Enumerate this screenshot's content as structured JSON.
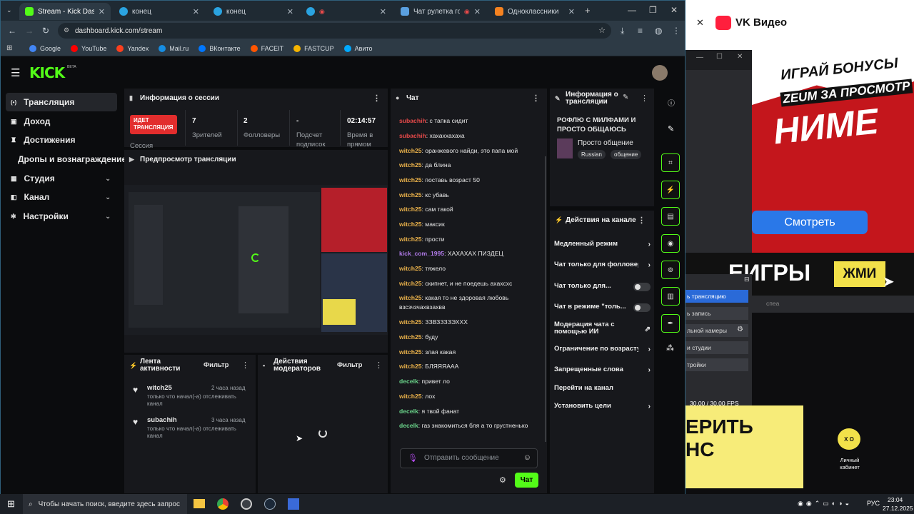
{
  "browser": {
    "tabs": [
      {
        "title": "Stream - Kick Dashboard",
        "color": "#53fc18"
      },
      {
        "title": "конец",
        "color": "#2aa3e0"
      },
      {
        "title": "конец",
        "color": "#2aa3e0"
      },
      {
        "title": "",
        "color": "#2aa3e0"
      },
      {
        "title": "Чат рулетка голос",
        "color": "#5aa0e0"
      },
      {
        "title": "Одноклассники",
        "color": "#f58220"
      }
    ],
    "url": "dashboard.kick.com/stream",
    "bookmarks": [
      "Google",
      "YouTube",
      "Yandex",
      "Mail.ru",
      "ВКонтакте",
      "FACEIT",
      "FASTCUP",
      "Авито"
    ]
  },
  "kick": {
    "logo": "KICK",
    "logo_badge": "BETA",
    "sidebar": [
      {
        "label": "Трансляция",
        "icon": "broadcast-icon"
      },
      {
        "label": "Доход",
        "icon": "wallet-icon"
      },
      {
        "label": "Достижения",
        "icon": "trophy-icon"
      },
      {
        "label": "Дропы и вознаграждение",
        "icon": ""
      },
      {
        "label": "Студия",
        "icon": "studio-icon"
      },
      {
        "label": "Канал",
        "icon": "channel-icon"
      },
      {
        "label": "Настройки",
        "icon": "gear-icon"
      }
    ],
    "session": {
      "title": "Информация о сессии",
      "live_badge": "ИДЕТ ТРАНСЛЯЦИЯ",
      "live_sub": "Сессия",
      "viewers_num": "7",
      "viewers_lbl": "Зрителей",
      "followers_num": "2",
      "followers_lbl": "Фолловеры",
      "subs_num": "-",
      "subs_lbl": "Подсчет подписок",
      "time_num": "02:14:57",
      "time_lbl": "Время в прямом"
    },
    "preview_title": "Предпросмотр трансляции",
    "activity": {
      "title": "Лента активности",
      "filter": "Фильтр",
      "items": [
        {
          "user": "witch25",
          "time": "2 часа назад",
          "text": "только что начал(-а) отслеживать канал"
        },
        {
          "user": "subachih",
          "time": "3 часа назад",
          "text": "только что начал(-а) отслеживать канал"
        }
      ]
    },
    "mod": {
      "title": "Действия модераторов",
      "filter": "Фильтр"
    },
    "chat": {
      "title": "Чат",
      "placeholder": "Отправить сообщение",
      "send": "Чат",
      "messages": [
        {
          "user": "subachih",
          "color": "#e84a4a",
          "text": ": с тапка сидит"
        },
        {
          "user": "subachih",
          "color": "#e84a4a",
          "text": ": хахаххахаха"
        },
        {
          "user": "witch25",
          "color": "#e8b04a",
          "text": ": оранжевого найди, это папа мой"
        },
        {
          "user": "witch25",
          "color": "#e8b04a",
          "text": ": да блина"
        },
        {
          "user": "witch25",
          "color": "#e8b04a",
          "text": ": поставь возраст 50"
        },
        {
          "user": "witch25",
          "color": "#e8b04a",
          "text": ": кс убавь"
        },
        {
          "user": "witch25",
          "color": "#e8b04a",
          "text": ": сам такой"
        },
        {
          "user": "witch25",
          "color": "#e8b04a",
          "text": ": максик"
        },
        {
          "user": "witch25",
          "color": "#e8b04a",
          "text": ": прости"
        },
        {
          "user": "kick_com_1995",
          "color": "#b07ae8",
          "text": ": ХАХАХАХ ПИЗДЕЦ"
        },
        {
          "user": "witch25",
          "color": "#e8b04a",
          "text": ": тяжело"
        },
        {
          "user": "witch25",
          "color": "#e8b04a",
          "text": ": скипнет, и не поедешь ахахсхс"
        },
        {
          "user": "witch25",
          "color": "#e8b04a",
          "text": ": какая то не здоровая любовь взсзчзчахвзахвв"
        },
        {
          "user": "witch25",
          "color": "#e8b04a",
          "text": ": ЗЗВЗЗЗЗЭХХХ"
        },
        {
          "user": "witch25",
          "color": "#e8b04a",
          "text": ": буду"
        },
        {
          "user": "witch25",
          "color": "#e8b04a",
          "text": ": злая какая"
        },
        {
          "user": "witch25",
          "color": "#e8b04a",
          "text": ": БЛЯЯЯААА"
        },
        {
          "user": "decelk",
          "color": "#6ad48a",
          "text": ": привет ло"
        },
        {
          "user": "witch25",
          "color": "#e8b04a",
          "text": ": лох"
        },
        {
          "user": "decelk",
          "color": "#6ad48a",
          "text": ": я твой фанат"
        },
        {
          "user": "decelk",
          "color": "#6ad48a",
          "text": ": газ знакомиться бля а то грустненько"
        }
      ]
    },
    "stream_info": {
      "title": "Информация о трансляции",
      "stream_title": "РОФЛЮ С МИЛФАМИ И ПРОСТО ОБЩАЮСЬ",
      "category": "Просто общение",
      "tags": [
        "Russian",
        "общение"
      ]
    },
    "actions": {
      "title": "Действия на канале",
      "items": [
        {
          "label": "Медленный режим",
          "type": "arrow"
        },
        {
          "label": "Чат только для фолловеров",
          "type": "arrow"
        },
        {
          "label": "Чат только для...",
          "type": "toggle"
        },
        {
          "label": "Чат в режиме \"толь...",
          "type": "toggle"
        },
        {
          "label": "Модерация чата с помощью ИИ",
          "type": "ext"
        },
        {
          "label": "Ограничение по возрасту",
          "type": "arrow"
        },
        {
          "label": "Запрещенные слова",
          "type": "arrow"
        },
        {
          "label": "Перейти на канал",
          "type": "none"
        },
        {
          "label": "Установить цели",
          "type": "arrow"
        }
      ]
    }
  },
  "vk": {
    "brand": "VK Видео",
    "banner_lines": [
      "ИГРАЙ БОНУСЫ",
      "ZEUM ЗА ПРОСМОТР",
      "НИМЕ"
    ],
    "watch_btn": "Смотреть",
    "games_text": "ЕИГРЫ",
    "press_text": "ЖМИ",
    "obs_items": [
      "ь трансляцию",
      "ь запись",
      "льной камеры",
      "и студии",
      "тройки"
    ],
    "obs_other": "спеа",
    "fps": "30.00 / 30.00 FPS",
    "check_text": [
      "ЕРИТЬ",
      "НС"
    ],
    "desktop_icon_label": "Личный кабинет",
    "desktop_icon_top": "X O"
  },
  "taskbar": {
    "search": "Чтобы начать поиск, введите здесь запрос",
    "lang": "РУС",
    "time": "23:04",
    "date": "27.12.2025"
  }
}
